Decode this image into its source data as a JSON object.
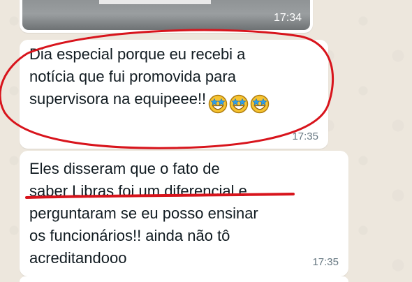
{
  "conversation": {
    "media_message": {
      "time": "17:34",
      "thumbnail_icon": "photo-thumbnail"
    },
    "messages": [
      {
        "text_before_emoji": "Dia especial porque eu recebi a\nnotícia que fui promovida para\nsupervisora na equipeee!!",
        "emojis": [
          "star-struck-emoji",
          "star-struck-emoji",
          "star-struck-emoji"
        ],
        "time": "17:35"
      },
      {
        "text": "Eles disseram que o fato de\nsaber Libras foi um diferencial e\nperguntaram se eu posso ensinar\nos funcionários!! ainda não tô\nacreditandooo",
        "time": "17:35"
      }
    ]
  },
  "annotations": {
    "color": "#d8141c",
    "circle_target": "message-1",
    "underline_target": "message-2 line 2"
  },
  "theme": {
    "bubble_bg": "#ffffff",
    "chat_bg": "#ede7dd",
    "text_color": "#111b21",
    "time_color": "#667781"
  }
}
